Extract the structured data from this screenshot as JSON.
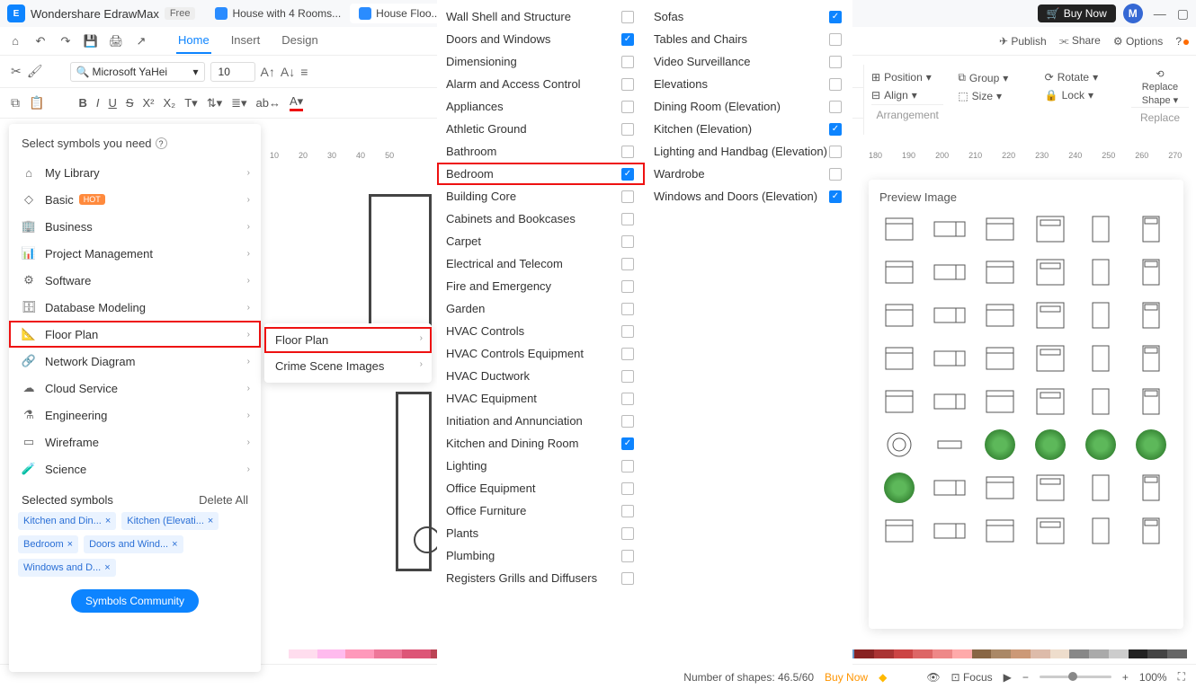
{
  "titlebar": {
    "app_name": "Wondershare EdrawMax",
    "free_badge": "Free",
    "tabs": [
      {
        "label": "House with 4 Rooms..."
      },
      {
        "label": "House Floo..."
      }
    ],
    "buy_now": "Buy Now",
    "avatar_initial": "M"
  },
  "menu": {
    "home": "Home",
    "insert": "Insert",
    "design": "Design"
  },
  "right_tools": {
    "publish": "Publish",
    "share": "Share",
    "options": "Options"
  },
  "format": {
    "font": "Microsoft YaHei",
    "size": "10"
  },
  "arrangement": {
    "position": "Position",
    "group": "Group",
    "rotate": "Rotate",
    "align": "Align",
    "size": "Size",
    "lock": "Lock",
    "label": "Arrangement",
    "replace_shape": "Replace Shape",
    "replace": "Replace"
  },
  "ruler_ticks": [
    "10",
    "20",
    "30",
    "40",
    "50",
    "180",
    "190",
    "200",
    "210",
    "220",
    "230",
    "240",
    "250",
    "260",
    "270"
  ],
  "symbols": {
    "title": "Select symbols you need",
    "categories": [
      {
        "label": "My Library"
      },
      {
        "label": "Basic",
        "hot": "HOT"
      },
      {
        "label": "Business"
      },
      {
        "label": "Project Management"
      },
      {
        "label": "Software"
      },
      {
        "label": "Database Modeling"
      },
      {
        "label": "Floor Plan",
        "highlighted": true
      },
      {
        "label": "Network Diagram"
      },
      {
        "label": "Cloud Service"
      },
      {
        "label": "Engineering"
      },
      {
        "label": "Wireframe"
      },
      {
        "label": "Science"
      }
    ],
    "selected_header": "Selected symbols",
    "delete_all": "Delete All",
    "chips": [
      "Kitchen and Din...",
      "Kitchen (Elevati...",
      "Bedroom",
      "Doors and Wind...",
      "Windows and D..."
    ],
    "community": "Symbols Community"
  },
  "flyout2": {
    "items": [
      {
        "label": "Floor Plan",
        "highlighted": true
      },
      {
        "label": "Crime Scene Images"
      }
    ]
  },
  "checkbox_col1": [
    {
      "label": "Wall Shell and Structure",
      "checked": false
    },
    {
      "label": "Doors and Windows",
      "checked": true
    },
    {
      "label": "Dimensioning",
      "checked": false
    },
    {
      "label": "Alarm and Access Control",
      "checked": false
    },
    {
      "label": "Appliances",
      "checked": false
    },
    {
      "label": "Athletic Ground",
      "checked": false
    },
    {
      "label": "Bathroom",
      "checked": false
    },
    {
      "label": "Bedroom",
      "checked": true,
      "highlighted": true
    },
    {
      "label": "Building Core",
      "checked": false
    },
    {
      "label": "Cabinets and Bookcases",
      "checked": false
    },
    {
      "label": "Carpet",
      "checked": false
    },
    {
      "label": "Electrical and Telecom",
      "checked": false
    },
    {
      "label": "Fire and Emergency",
      "checked": false
    },
    {
      "label": "Garden",
      "checked": false
    },
    {
      "label": "HVAC Controls",
      "checked": false
    },
    {
      "label": "HVAC Controls Equipment",
      "checked": false
    },
    {
      "label": "HVAC Ductwork",
      "checked": false
    },
    {
      "label": "HVAC Equipment",
      "checked": false
    },
    {
      "label": "Initiation and Annunciation",
      "checked": false
    },
    {
      "label": "Kitchen and Dining Room",
      "checked": true
    },
    {
      "label": "Lighting",
      "checked": false
    },
    {
      "label": "Office Equipment",
      "checked": false
    },
    {
      "label": "Office Furniture",
      "checked": false
    },
    {
      "label": "Plants",
      "checked": false
    },
    {
      "label": "Plumbing",
      "checked": false
    },
    {
      "label": "Registers Grills and Diffusers",
      "checked": false
    }
  ],
  "checkbox_col2": [
    {
      "label": "Sofas",
      "checked": true
    },
    {
      "label": "Tables and Chairs",
      "checked": false
    },
    {
      "label": "Video Surveillance",
      "checked": false
    },
    {
      "label": "Elevations",
      "checked": false
    },
    {
      "label": "Dining Room (Elevation)",
      "checked": false
    },
    {
      "label": "Kitchen (Elevation)",
      "checked": true
    },
    {
      "label": "Lighting and Handbag (Elevation)",
      "checked": false
    },
    {
      "label": "Wardrobe",
      "checked": false
    },
    {
      "label": "Windows and Doors (Elevation)",
      "checked": true
    }
  ],
  "preview": {
    "title": "Preview Image"
  },
  "swatch_colors": [
    "#fff",
    "#f7cfe0",
    "#f3a8c5",
    "#e87aa6",
    "#d94e86",
    "#c0306a",
    "#a6265a",
    "#8a1d4a",
    "#f5d6b0",
    "#efb98a",
    "#e69c63",
    "#d97f3a",
    "#c46626",
    "#a65419",
    "#7b3e12",
    "#5b2d0d"
  ],
  "status": {
    "shapes": "Number of shapes: 46.5/60",
    "buy_now": "Buy Now",
    "focus": "Focus",
    "zoom": "100%"
  }
}
